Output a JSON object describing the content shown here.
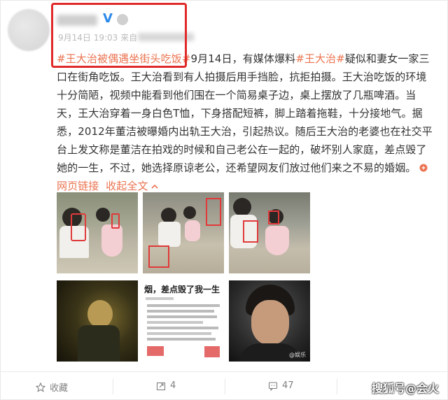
{
  "post": {
    "meta_date": "9月14日 19:03 来自",
    "content": {
      "topic1": "#王大治被偶遇坐街头吃饭#",
      "text1": "9月14日，有媒体爆料",
      "topic2": "#王大治#",
      "text2": "疑似和妻女一家三口在街角吃饭。王大治看到有人拍摄后用手挡脸，抗拒拍摄。王大治吃饭的环境十分简陋，视频中能看到他们围在一个简易桌子边，桌上摆放了几瓶啤酒。当天，王大治穿着一身白色T恤，下身搭配短裤，脚上踏着拖鞋，十分接地气。据悉，2012年董洁被曝婚内出轨王大治，引起热议。随后王大治的老婆也在社交平台上发文称是董洁在拍戏的时候和自己老公在一起的，破坏别人家庭，差点毁了她的一生，不过，她选择原谅老公，还希望网友们放过他们来之不易的婚姻。",
      "link_label": "网页链接",
      "collapse_label": "收起全文"
    }
  },
  "images": {
    "panel_title": "烟，差点毁了我一生",
    "panel_caption": "@娱乐"
  },
  "footer": {
    "favorite_label": "收藏",
    "repost_count": "4",
    "comment_count": "47",
    "watermark": "搜狐号@会火"
  },
  "colors": {
    "accent": "#eb7350",
    "highlight_box": "#e02a2a",
    "verified": "#2c8ae8"
  }
}
